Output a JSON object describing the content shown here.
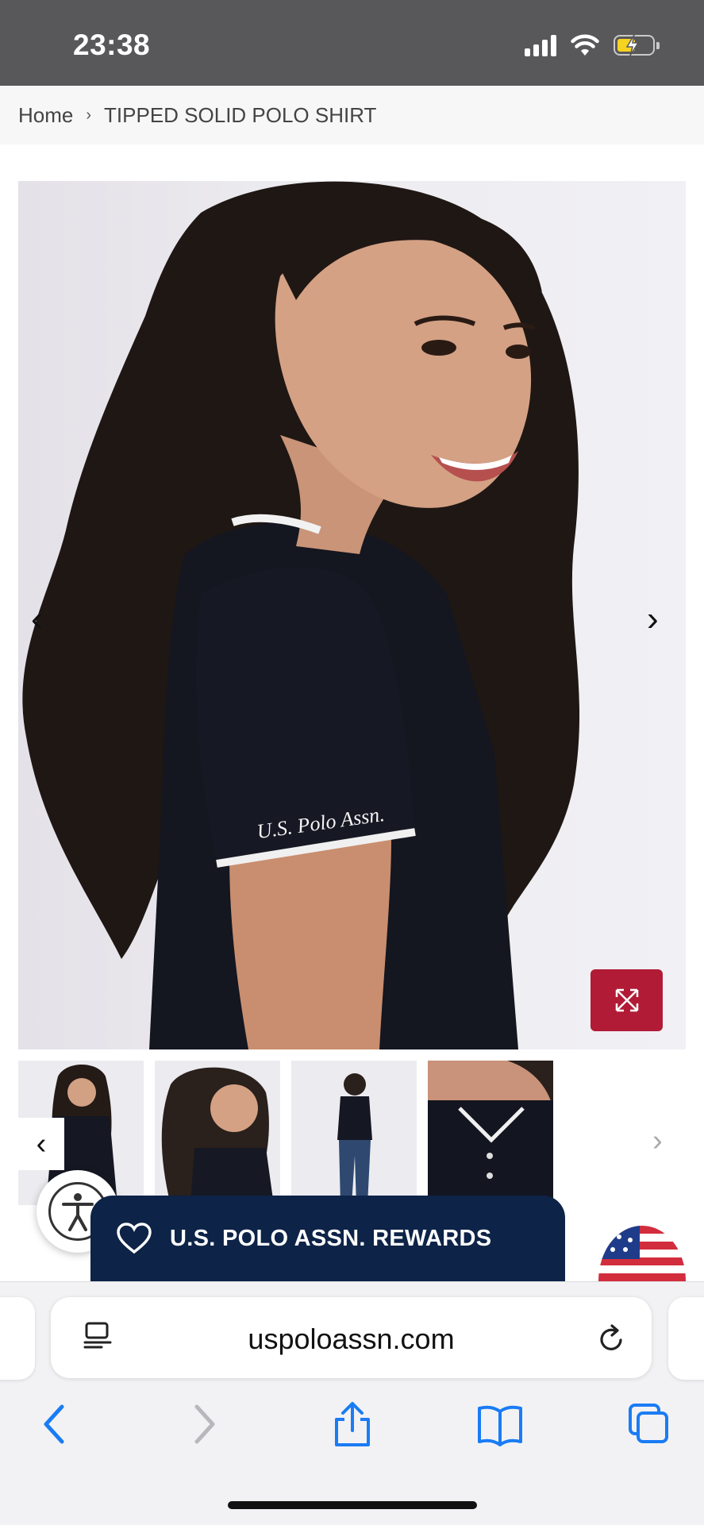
{
  "status_bar": {
    "time": "23:38",
    "battery": "charging"
  },
  "breadcrumb": {
    "home": "Home",
    "separator": "›",
    "current": "TIPPED SOLID POLO SHIRT"
  },
  "gallery": {
    "main_image": "model-side-smile-black-polo",
    "sleeve_text": "U.S. Polo Assn.",
    "prev_arrow": "‹",
    "next_arrow": "›",
    "expand_icon": "expand-arrows-icon",
    "thumbnails": [
      "thumb-front",
      "thumb-side-smile",
      "thumb-full-body",
      "thumb-collar-closeup"
    ],
    "thumb_prev": "‹",
    "thumb_next": "›"
  },
  "rewards": {
    "label": "U.S. POLO ASSN. REWARDS",
    "icon": "heart-icon"
  },
  "accessibility": {
    "icon": "accessibility-icon"
  },
  "browser": {
    "url": "uspoloassn.com"
  },
  "colors": {
    "accent": "#b11b36",
    "navy": "#0d2347",
    "ios_blue": "#1a7cf5",
    "status_bg": "#58585a"
  }
}
